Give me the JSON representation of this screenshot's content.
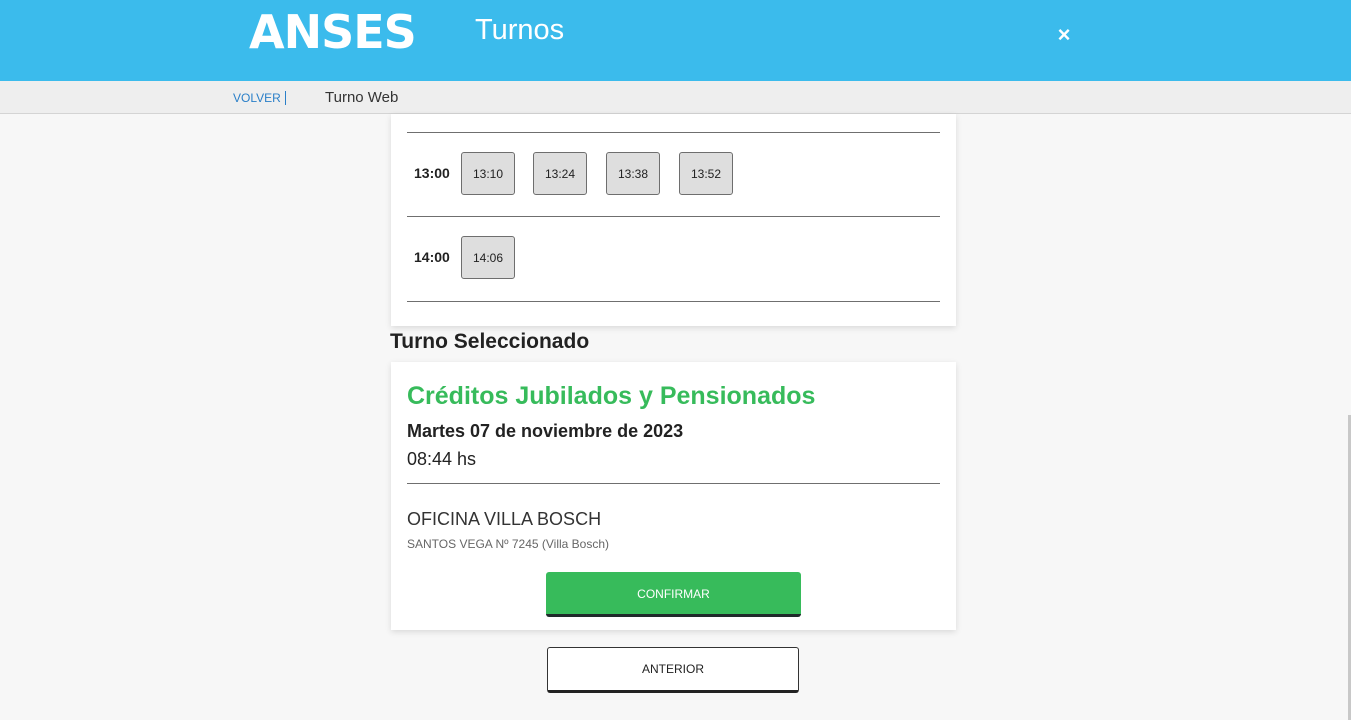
{
  "header": {
    "logo": "ANSES",
    "title": "Turnos",
    "close_icon": "close-icon",
    "close_glyph": "×"
  },
  "subnav": {
    "back_label": "VOLVER",
    "title": "Turno Web"
  },
  "slots": {
    "groups": [
      {
        "hour": "13:00",
        "times": [
          "13:10",
          "13:24",
          "13:38",
          "13:52"
        ]
      },
      {
        "hour": "14:00",
        "times": [
          "14:06"
        ]
      }
    ]
  },
  "selected": {
    "section_title": "Turno Seleccionado",
    "service": "Créditos Jubilados y Pensionados",
    "date": "Martes 07 de noviembre de 2023",
    "time": "08:44 hs",
    "office": "OFICINA VILLA BOSCH",
    "address": "SANTOS VEGA Nº 7245 (Villa Bosch)",
    "confirm_label": "CONFIRMAR"
  },
  "footer": {
    "prev_label": "ANTERIOR"
  },
  "colors": {
    "header_bg": "#3bbbec",
    "accent_green": "#37bb5b",
    "link_blue": "#2a7fc8"
  }
}
